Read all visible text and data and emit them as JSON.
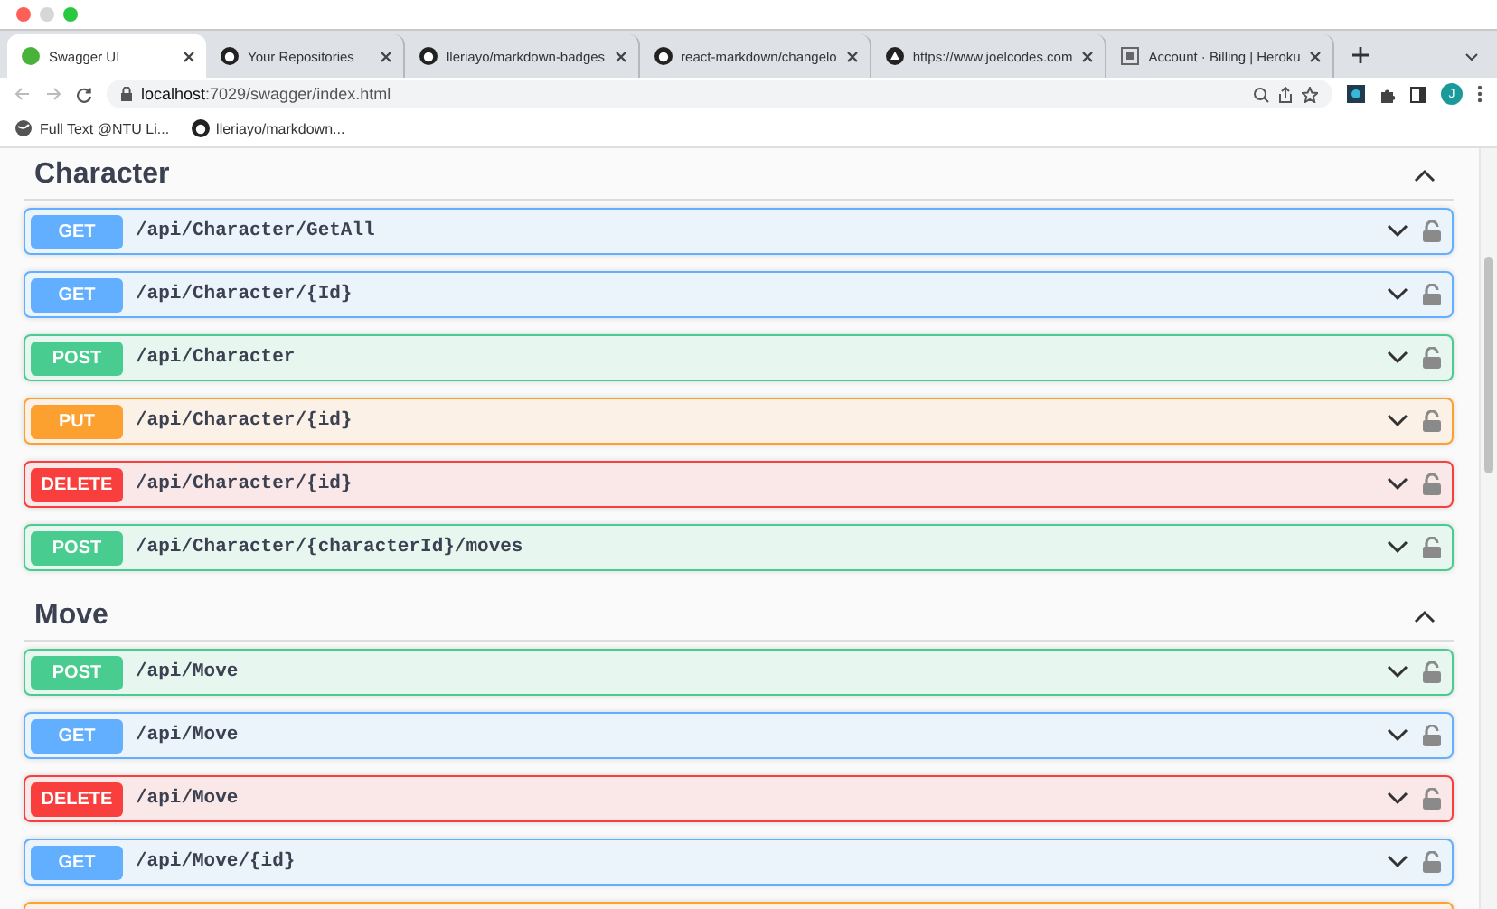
{
  "browser": {
    "tabs": [
      {
        "title": "Swagger UI",
        "selected": true
      },
      {
        "title": "Your Repositories",
        "selected": false
      },
      {
        "title": "lleriayo/markdown-badges",
        "selected": false
      },
      {
        "title": "react-markdown/changelo",
        "selected": false
      },
      {
        "title": "https://www.joelcodes.com",
        "selected": false
      },
      {
        "title": "Account · Billing | Heroku",
        "selected": false
      }
    ],
    "address": {
      "host": "localhost",
      "path": ":7029/swagger/index.html"
    },
    "profile": "J",
    "bookmarks": [
      {
        "title": "Full Text @NTU Li..."
      },
      {
        "title": "lleriayo/markdown..."
      }
    ]
  },
  "sections": [
    {
      "title": "Character",
      "expanded": true,
      "operations": [
        {
          "kind": "get",
          "method": "GET",
          "path": "/api/Character/GetAll"
        },
        {
          "kind": "get",
          "method": "GET",
          "path": "/api/Character/{Id}"
        },
        {
          "kind": "post",
          "method": "POST",
          "path": "/api/Character"
        },
        {
          "kind": "put",
          "method": "PUT",
          "path": "/api/Character/{id}"
        },
        {
          "kind": "delete",
          "method": "DELETE",
          "path": "/api/Character/{id}"
        },
        {
          "kind": "post",
          "method": "POST",
          "path": "/api/Character/{characterId}/moves"
        }
      ]
    },
    {
      "title": "Move",
      "expanded": true,
      "operations": [
        {
          "kind": "post",
          "method": "POST",
          "path": "/api/Move"
        },
        {
          "kind": "get",
          "method": "GET",
          "path": "/api/Move"
        },
        {
          "kind": "delete",
          "method": "DELETE",
          "path": "/api/Move"
        },
        {
          "kind": "get",
          "method": "GET",
          "path": "/api/Move/{id}"
        },
        {
          "kind": "put"
        }
      ]
    }
  ]
}
